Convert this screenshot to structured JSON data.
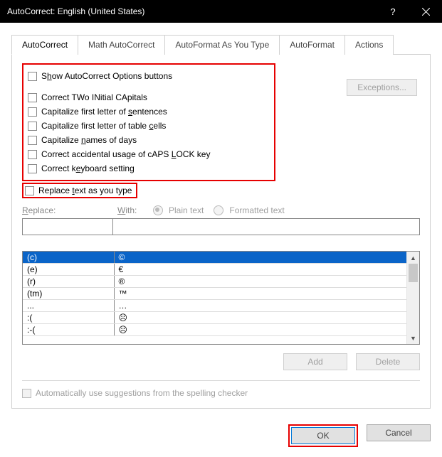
{
  "title": "AutoCorrect: English (United States)",
  "tabs": {
    "autocorrect": "AutoCorrect",
    "math": "Math AutoCorrect",
    "asyoutype": "AutoFormat As You Type",
    "autoformat": "AutoFormat",
    "actions": "Actions"
  },
  "checks": {
    "show_options": "Show AutoCorrect Options buttons",
    "two_initial": "Correct TWo INitial CApitals",
    "first_sentence": "Capitalize first letter of sentences",
    "first_table": "Capitalize first letter of table cells",
    "names_days": "Capitalize names of days",
    "caps_lock": "Correct accidental usage of cAPS LOCK key",
    "keyboard": "Correct keyboard setting",
    "replace_type": "Replace text as you type"
  },
  "labels": {
    "exceptions": "Exceptions...",
    "replace": "Replace:",
    "with": "With:",
    "plain": "Plain text",
    "formatted": "Formatted text",
    "add": "Add",
    "delete": "Delete",
    "suggestions": "Automatically use suggestions from the spelling checker",
    "ok": "OK",
    "cancel": "Cancel"
  },
  "table": [
    {
      "from": "(c)",
      "to": "©"
    },
    {
      "from": "(e)",
      "to": "€"
    },
    {
      "from": "(r)",
      "to": "®"
    },
    {
      "from": "(tm)",
      "to": "™"
    },
    {
      "from": "...",
      "to": "…"
    },
    {
      "from": ":(",
      "to": "☹"
    },
    {
      "from": ":-(",
      "to": "☹"
    }
  ]
}
